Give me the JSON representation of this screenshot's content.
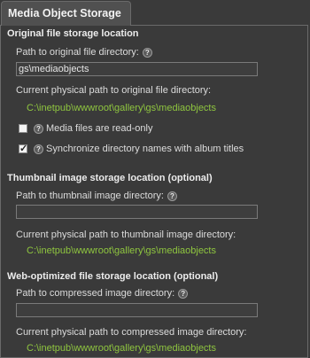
{
  "tab": {
    "title": "Media Object Storage"
  },
  "original": {
    "section_title": "Original file storage location",
    "path_label": "Path to original file directory:",
    "path_value": "gs\\mediaobjects",
    "physical_label": "Current physical path to original file directory:",
    "physical_path": "C:\\inetpub\\wwwroot\\gallery\\gs\\mediaobjects",
    "readonly_label": "Media files are read-only",
    "readonly_checked": false,
    "sync_label": "Synchronize directory names with album titles",
    "sync_checked": true
  },
  "thumbnail": {
    "section_title": "Thumbnail image storage location (optional)",
    "path_label": "Path to thumbnail image directory:",
    "path_value": "",
    "physical_label": "Current physical path to thumbnail image directory:",
    "physical_path": "C:\\inetpub\\wwwroot\\gallery\\gs\\mediaobjects"
  },
  "optimized": {
    "section_title": "Web-optimized file storage location (optional)",
    "path_label": "Path to compressed image directory:",
    "path_value": "",
    "physical_label": "Current physical path to compressed image directory:",
    "physical_path": "C:\\inetpub\\wwwroot\\gallery\\gs\\mediaobjects"
  },
  "help_glyph": "?",
  "colors": {
    "path_green": "#8fc63f",
    "background": "#3a3a3a"
  }
}
